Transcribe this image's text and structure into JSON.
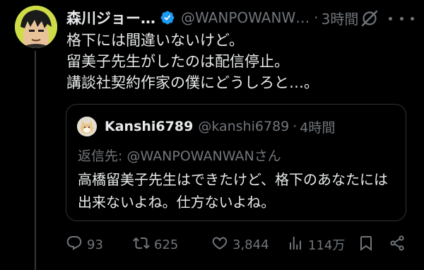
{
  "post": {
    "author": {
      "display_name": "森川ジョー…",
      "handle": "@WANPOWANW…",
      "verified": true
    },
    "dot": "·",
    "time": "3時間",
    "text_lines": [
      "格下には間違いないけど。",
      "留美子先生がしたのは配信停止。",
      "講談社契約作家の僕にどうしろと…。"
    ]
  },
  "quote": {
    "author": {
      "display_name": "Kanshi6789",
      "handle": "@kanshi6789"
    },
    "dot": "·",
    "time": "4時間",
    "reply_to": "返信先: @WANPOWANWANさん",
    "text_lines": [
      "高橋留美子先生はできたけど、格下のあなたには",
      "出来ないよね。仕方ないよね。"
    ]
  },
  "actions": {
    "replies": "93",
    "reposts": "625",
    "likes": "3,844",
    "views": "114万"
  },
  "colors": {
    "background": "#000000",
    "text": "#e7e9ea",
    "muted": "#71767b",
    "verified": "#1d9bf0",
    "border": "#2f3336"
  }
}
